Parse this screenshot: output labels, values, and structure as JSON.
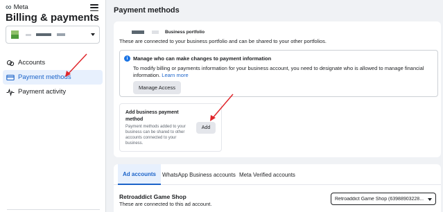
{
  "sidebar": {
    "logo_text": "Meta",
    "title": "Billing & payments",
    "items": [
      {
        "label": "Accounts",
        "icon": "accounts-icon"
      },
      {
        "label": "Payment methods",
        "icon": "credit-card-icon",
        "active": true
      },
      {
        "label": "Payment activity",
        "icon": "activity-pulse-icon"
      }
    ]
  },
  "main": {
    "page_title": "Payment methods",
    "business_portfolio": {
      "badge": "Business portfolio",
      "description": "These are connected to your business portfolio and can be shared to your other portfolios."
    },
    "info_box": {
      "title": "Manage who can make changes to payment information",
      "body": "To modify billing or payments information for your business account, you need to designate who is allowed to manage financial information.",
      "link": "Learn more",
      "button": "Manage Access"
    },
    "add_card": {
      "title": "Add business payment method",
      "description": "Payment methods added to your business can be shared to other accounts connected to your business.",
      "button": "Add"
    },
    "tabs": [
      {
        "label": "Ad accounts",
        "active": true
      },
      {
        "label": "WhatsApp Business accounts"
      },
      {
        "label": "Meta Verified accounts"
      }
    ],
    "ad_account": {
      "name": "Retroaddict Game Shop",
      "description": "These are connected to this ad account.",
      "selected": "Retroaddict Game Shop (63988903228..."
    }
  },
  "colors": {
    "accent": "#1b63c9",
    "active_bg": "#e7f0fd",
    "annotation_arrow": "#e0262b"
  }
}
